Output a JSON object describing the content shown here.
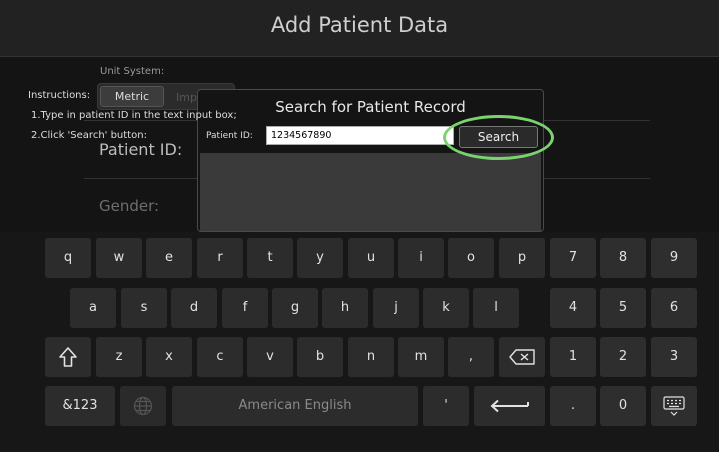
{
  "header": {
    "title": "Add Patient Data"
  },
  "form": {
    "unit_system_label": "Unit System:",
    "unit_metric": "Metric",
    "unit_imperial": "Imp",
    "patient_id_label": "Patient ID:",
    "gender_label": "Gender:"
  },
  "dialog": {
    "title": "Search for Patient Record",
    "patient_id_label": "Patient ID:",
    "patient_id_value": "1234567890",
    "search_button": "Search",
    "instructions_title": "Instructions:",
    "instruction_1": "1.Type in patient ID in the text input box;",
    "instruction_2": "2.Click 'Search' button:"
  },
  "keyboard": {
    "row1": [
      "q",
      "w",
      "e",
      "r",
      "t",
      "y",
      "u",
      "i",
      "o",
      "p"
    ],
    "row2": [
      "a",
      "s",
      "d",
      "f",
      "g",
      "h",
      "j",
      "k",
      "l"
    ],
    "row3": [
      "z",
      "x",
      "c",
      "v",
      "b",
      "n",
      "m",
      ","
    ],
    "numpad_row1": [
      "7",
      "8",
      "9"
    ],
    "numpad_row2": [
      "4",
      "5",
      "6"
    ],
    "numpad_row3": [
      "1",
      "2",
      "3"
    ],
    "mode_key": "&123",
    "space_label": "American English",
    "apostrophe": "'",
    "period": ".",
    "zero": "0"
  },
  "accent_color": "#7bd36f"
}
